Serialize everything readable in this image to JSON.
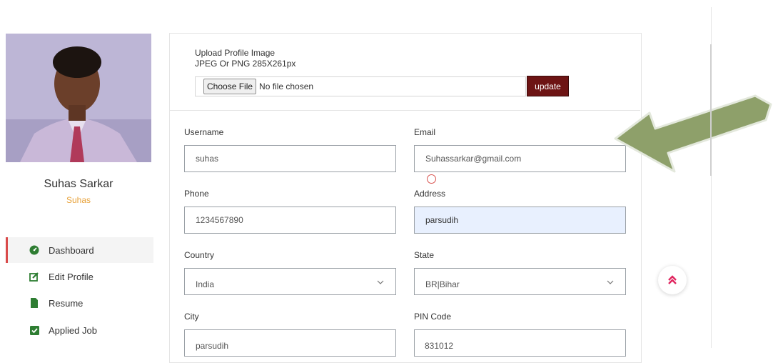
{
  "sidebar": {
    "name": "Suhas Sarkar",
    "username": "Suhas",
    "items": [
      {
        "label": "Dashboard",
        "icon": "dashboard-icon",
        "active": true
      },
      {
        "label": "Edit Profile",
        "icon": "edit-icon",
        "active": false
      },
      {
        "label": "Resume",
        "icon": "file-icon",
        "active": false
      },
      {
        "label": "Applied Job",
        "icon": "checkbox-icon",
        "active": false
      }
    ]
  },
  "upload": {
    "title": "Upload Profile Image",
    "hint": "JPEG Or PNG 285X261px",
    "choose_label": "Choose File",
    "file_status": "No file chosen",
    "update_label": "update"
  },
  "form": {
    "username": {
      "label": "Username",
      "value": "suhas"
    },
    "email": {
      "label": "Email",
      "value": "Suhassarkar@gmail.com"
    },
    "phone": {
      "label": "Phone",
      "value": "1234567890"
    },
    "address": {
      "label": "Address",
      "value": "parsudih"
    },
    "country": {
      "label": "Country",
      "value": "India"
    },
    "state": {
      "label": "State",
      "value": "BR|Bihar"
    },
    "city": {
      "label": "City",
      "value": "parsudih"
    },
    "pin": {
      "label": "PIN Code",
      "value": "831012"
    }
  },
  "colors": {
    "accent": "#d94a4a",
    "update_button": "#6d1414",
    "highlight_field": "#e8f0fe",
    "arrow": "#8ea06a",
    "icon_green": "#2e7d32"
  }
}
